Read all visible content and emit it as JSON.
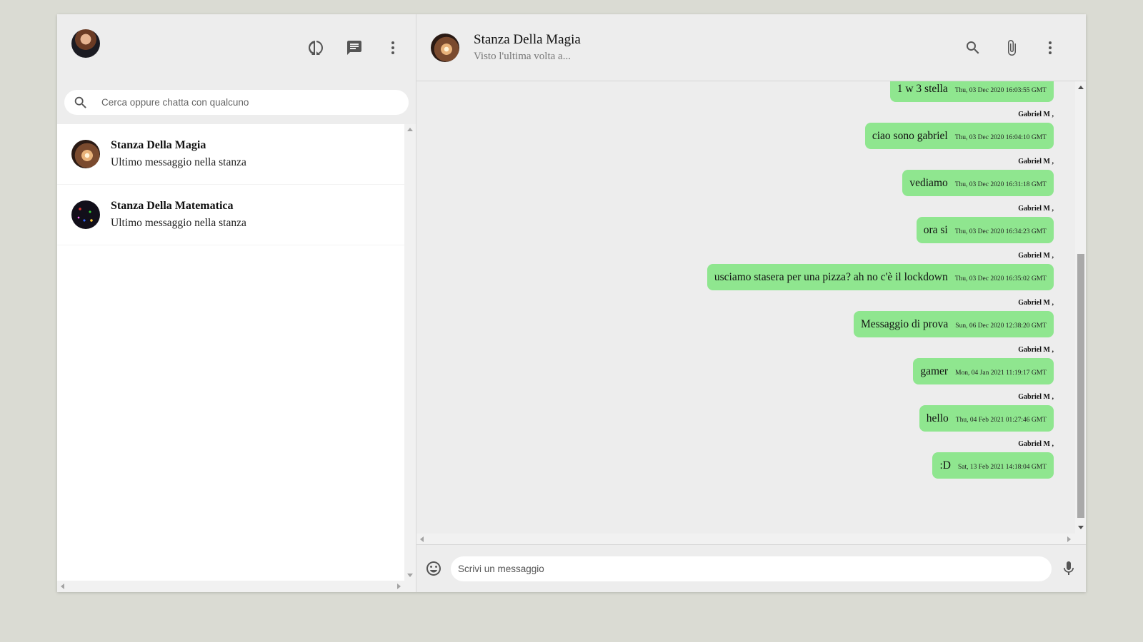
{
  "sidebar": {
    "user_avatar": "user-avatar",
    "icons": [
      "status-icon",
      "new-chat-icon",
      "more-vert-icon"
    ],
    "search": {
      "placeholder": "Cerca oppure chatta con qualcuno"
    },
    "chats": [
      {
        "name": "Stanza Della Magia",
        "last_message": "Ultimo messaggio nella stanza"
      },
      {
        "name": "Stanza Della Matematica",
        "last_message": "Ultimo messaggio nella stanza"
      }
    ]
  },
  "room": {
    "title": "Stanza Della Magia",
    "subtitle": "Visto l'ultima volta a...",
    "icons": [
      "search-icon",
      "attach-icon",
      "more-vert-icon"
    ]
  },
  "messages": [
    {
      "author": "",
      "text": "1 w 3 stella",
      "time": "Thu, 03 Dec 2020 16:03:55 GMT"
    },
    {
      "author": "Gabriel M ,",
      "text": "ciao sono gabriel",
      "time": "Thu, 03 Dec 2020 16:04:10 GMT"
    },
    {
      "author": "Gabriel M ,",
      "text": "vediamo",
      "time": "Thu, 03 Dec 2020 16:31:18 GMT"
    },
    {
      "author": "Gabriel M ,",
      "text": "ora si",
      "time": "Thu, 03 Dec 2020 16:34:23 GMT"
    },
    {
      "author": "Gabriel M ,",
      "text": "usciamo stasera per una pizza? ah no c'è il lockdown",
      "time": "Thu, 03 Dec 2020 16:35:02 GMT"
    },
    {
      "author": "Gabriel M ,",
      "text": "Messaggio di prova",
      "time": "Sun, 06 Dec 2020 12:38:20 GMT"
    },
    {
      "author": "Gabriel M ,",
      "text": "gamer",
      "time": "Mon, 04 Jan 2021 11:19:17 GMT"
    },
    {
      "author": "Gabriel M ,",
      "text": "hello",
      "time": "Thu, 04 Feb 2021 01:27:46 GMT"
    },
    {
      "author": "Gabriel M ,",
      "text": ":D",
      "time": "Sat, 13 Feb 2021 14:18:04 GMT"
    }
  ],
  "composer": {
    "placeholder": "Scrivi un messaggio"
  },
  "colors": {
    "bubble": "#8fe68f",
    "panel": "#ededed",
    "background": "#dadbd3"
  }
}
